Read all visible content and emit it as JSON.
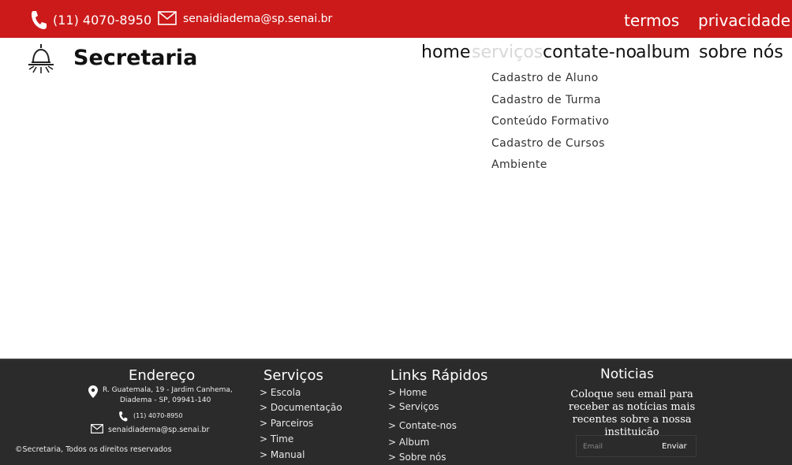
{
  "topbar": {
    "phone": "(11) 4070-8950",
    "email": "senaidiadema@sp.senai.br",
    "termos": "termos",
    "privacidade": "privacidade",
    "icons": [
      "phone-icon",
      "mail-icon"
    ]
  },
  "header": {
    "brand": "Secretaria",
    "logo_icon": "lamp-icon"
  },
  "nav": {
    "items": [
      {
        "label": "home"
      },
      {
        "label": "serviços",
        "active": true
      },
      {
        "label": "contate-no"
      },
      {
        "label": "album"
      },
      {
        "label": "sobre nós"
      }
    ]
  },
  "dropdown": {
    "items": [
      "Cadastro de Aluno",
      "Cadastro de Turma",
      "Conteúdo Formativo",
      "Cadastro de Cursos",
      "Ambiente"
    ]
  },
  "footer": {
    "address": {
      "heading": "Endereço",
      "line1": "R. Guatemala, 19 - Jardim Canhema,",
      "line2": "Diadema - SP, 09941-140",
      "phone": "(11) 4070-8950",
      "email": "senaidiadema@sp.senai.br"
    },
    "copyright": "©Secretaria, Todos os direitos reservados",
    "services": {
      "heading": "Serviços",
      "items": [
        "> Escola",
        "> Documentação",
        "> Parceiros",
        "> Time",
        "> Manual"
      ]
    },
    "quick_links": {
      "heading": "Links Rápidos",
      "items": [
        "> Home",
        "> Serviços",
        "> Contate-nos",
        "> Album",
        "> Sobre nós"
      ]
    },
    "news": {
      "heading": "Noticias",
      "description": "Coloque seu email para receber as notícias mais recentes sobre a nossa instituição",
      "placeholder": "Email",
      "button": "Enviar"
    }
  },
  "colors": {
    "topbar": "#cc1a1a",
    "footer": "#2b2b2b",
    "nav_active": "#d8d8d8"
  }
}
